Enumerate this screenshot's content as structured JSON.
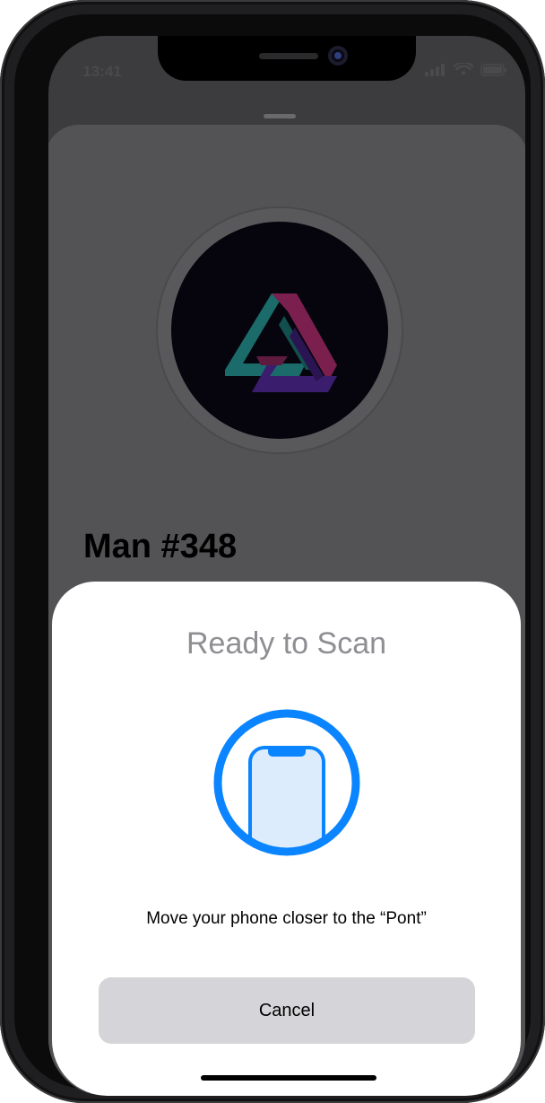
{
  "status_bar": {
    "time": "13:41",
    "icons": [
      "signal-icon",
      "wifi-icon",
      "battery-icon"
    ]
  },
  "nft": {
    "title": "Man #348",
    "image_icon": "impossible-triangle-logo"
  },
  "scan_sheet": {
    "title": "Ready to Scan",
    "icon": "phone-scan-icon",
    "instruction": "Move your phone closer to the “Pont”",
    "cancel_label": "Cancel"
  },
  "colors": {
    "accent_blue": "#0a84ff",
    "phone_fill": "#dcecfd",
    "title_gray": "#8e8e93",
    "button_gray": "#d5d5d9",
    "logo_teal": "#1a6b6a",
    "logo_magenta": "#7a1f4e",
    "logo_purple": "#3b1d6e"
  }
}
